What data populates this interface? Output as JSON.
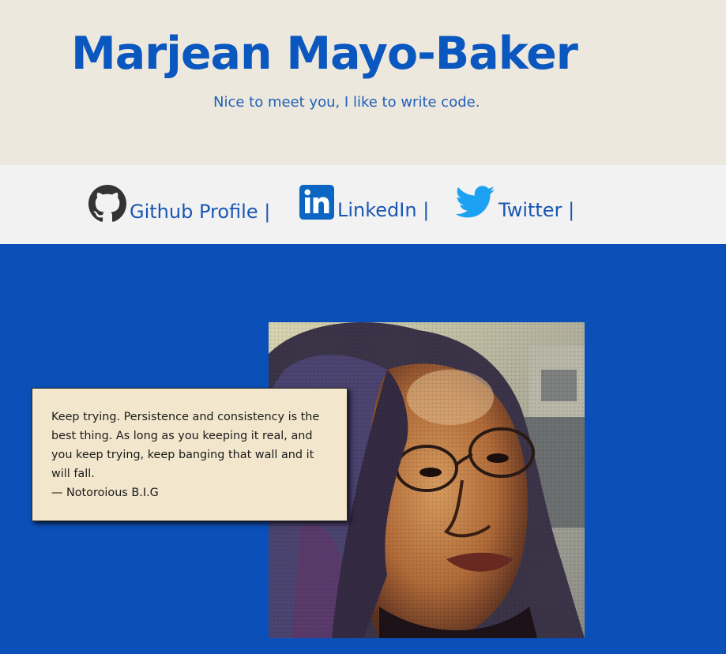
{
  "header": {
    "name": "Marjean Mayo-Baker",
    "tagline": "Nice to meet you, I like to write code."
  },
  "social": {
    "links": [
      {
        "icon": "github-icon",
        "label": "Github Profile |"
      },
      {
        "icon": "linkedin-icon",
        "label": "LinkedIn |"
      },
      {
        "icon": "twitter-icon",
        "label": "Twitter |"
      }
    ]
  },
  "hero": {
    "quote": "Keep trying. Persistence and consistency is the best thing. As long as you keeping it real, and you keep trying, keep banging that wall and it will fall.",
    "author": "— Notoroious B.I.G",
    "portrait_icon": "portrait-photo"
  },
  "colors": {
    "header_bg": "#ede8dd",
    "brand_blue": "#0a57bf",
    "nav_bg": "#f2f2f2",
    "hero_bg": "#0a50b8",
    "quote_bg": "#f2e6cd",
    "linkedin_blue": "#0a66c2",
    "twitter_blue": "#1da1f2"
  }
}
